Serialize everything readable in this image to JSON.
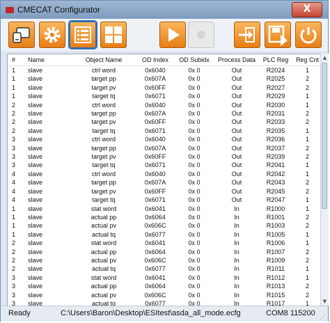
{
  "window": {
    "title": "CMECAT Configurator",
    "close_label": "X"
  },
  "toolbar": {
    "buttons": [
      {
        "name": "connect-icon",
        "state": "normal"
      },
      {
        "name": "settings-gear-icon",
        "state": "normal"
      },
      {
        "name": "list-view-icon",
        "state": "selected"
      },
      {
        "name": "grid-view-icon",
        "state": "normal"
      },
      {
        "name": "run-play-icon",
        "state": "normal"
      },
      {
        "name": "record-icon",
        "state": "disabled"
      },
      {
        "name": "import-icon",
        "state": "normal"
      },
      {
        "name": "save-icon",
        "state": "normal"
      },
      {
        "name": "power-icon",
        "state": "normal"
      }
    ],
    "accent_color": "#ee8a1c"
  },
  "table": {
    "headers": [
      "#",
      "Name",
      "Object Name",
      "OD Index",
      "OD Subidx",
      "Process Data",
      "PLC Reg",
      "Reg Cnt"
    ],
    "rows": [
      [
        "1",
        "slave",
        "ctrl word",
        "0x6040",
        "0x 0",
        "Out",
        "R2024",
        "1"
      ],
      [
        "1",
        "slave",
        "target pp",
        "0x607A",
        "0x 0",
        "Out",
        "R2025",
        "2"
      ],
      [
        "1",
        "slave",
        "target pv",
        "0x60FF",
        "0x 0",
        "Out",
        "R2027",
        "2"
      ],
      [
        "1",
        "slave",
        "target tq",
        "0x6071",
        "0x 0",
        "Out",
        "R2029",
        "1"
      ],
      [
        "2",
        "slave",
        "ctrl word",
        "0x6040",
        "0x 0",
        "Out",
        "R2030",
        "1"
      ],
      [
        "2",
        "slave",
        "target pp",
        "0x607A",
        "0x 0",
        "Out",
        "R2031",
        "2"
      ],
      [
        "2",
        "slave",
        "target pv",
        "0x60FF",
        "0x 0",
        "Out",
        "R2033",
        "2"
      ],
      [
        "2",
        "slave",
        "target tq",
        "0x6071",
        "0x 0",
        "Out",
        "R2035",
        "1"
      ],
      [
        "3",
        "slave",
        "ctrl word",
        "0x6040",
        "0x 0",
        "Out",
        "R2036",
        "1"
      ],
      [
        "3",
        "slave",
        "target pp",
        "0x607A",
        "0x 0",
        "Out",
        "R2037",
        "2"
      ],
      [
        "3",
        "slave",
        "target pv",
        "0x60FF",
        "0x 0",
        "Out",
        "R2039",
        "2"
      ],
      [
        "3",
        "slave",
        "target tq",
        "0x6071",
        "0x 0",
        "Out",
        "R2041",
        "1"
      ],
      [
        "4",
        "slave",
        "ctrl word",
        "0x6040",
        "0x 0",
        "Out",
        "R2042",
        "1"
      ],
      [
        "4",
        "slave",
        "target pp",
        "0x607A",
        "0x 0",
        "Out",
        "R2043",
        "2"
      ],
      [
        "4",
        "slave",
        "target pv",
        "0x60FF",
        "0x 0",
        "Out",
        "R2045",
        "2"
      ],
      [
        "4",
        "slave",
        "target tq",
        "0x6071",
        "0x 0",
        "Out",
        "R2047",
        "1"
      ],
      [
        "1",
        "slave",
        "stat word",
        "0x6041",
        "0x 0",
        "In",
        "R1000",
        "1"
      ],
      [
        "1",
        "slave",
        "actual pp",
        "0x6064",
        "0x 0",
        "In",
        "R1001",
        "2"
      ],
      [
        "1",
        "slave",
        "actual pv",
        "0x606C",
        "0x 0",
        "In",
        "R1003",
        "2"
      ],
      [
        "1",
        "slave",
        "actual tq",
        "0x6077",
        "0x 0",
        "In",
        "R1005",
        "1"
      ],
      [
        "2",
        "slave",
        "stat word",
        "0x6041",
        "0x 0",
        "In",
        "R1006",
        "1"
      ],
      [
        "2",
        "slave",
        "actual pp",
        "0x6064",
        "0x 0",
        "In",
        "R1007",
        "2"
      ],
      [
        "2",
        "slave",
        "actual pv",
        "0x606C",
        "0x 0",
        "In",
        "R1009",
        "2"
      ],
      [
        "2",
        "slave",
        "actual tq",
        "0x6077",
        "0x 0",
        "In",
        "R1011",
        "1"
      ],
      [
        "3",
        "slave",
        "stat word",
        "0x6041",
        "0x 0",
        "In",
        "R1012",
        "1"
      ],
      [
        "3",
        "slave",
        "actual pp",
        "0x6064",
        "0x 0",
        "In",
        "R1013",
        "2"
      ],
      [
        "3",
        "slave",
        "actual pv",
        "0x606C",
        "0x 0",
        "In",
        "R1015",
        "2"
      ],
      [
        "3",
        "slave",
        "actual tq",
        "0x6077",
        "0x 0",
        "In",
        "R1017",
        "1"
      ]
    ]
  },
  "status": {
    "ready": "Ready",
    "file": "C:\\Users\\Baron\\Desktop\\ESItest\\asda_all_mode.ecfg",
    "port": "COM8  115200"
  }
}
